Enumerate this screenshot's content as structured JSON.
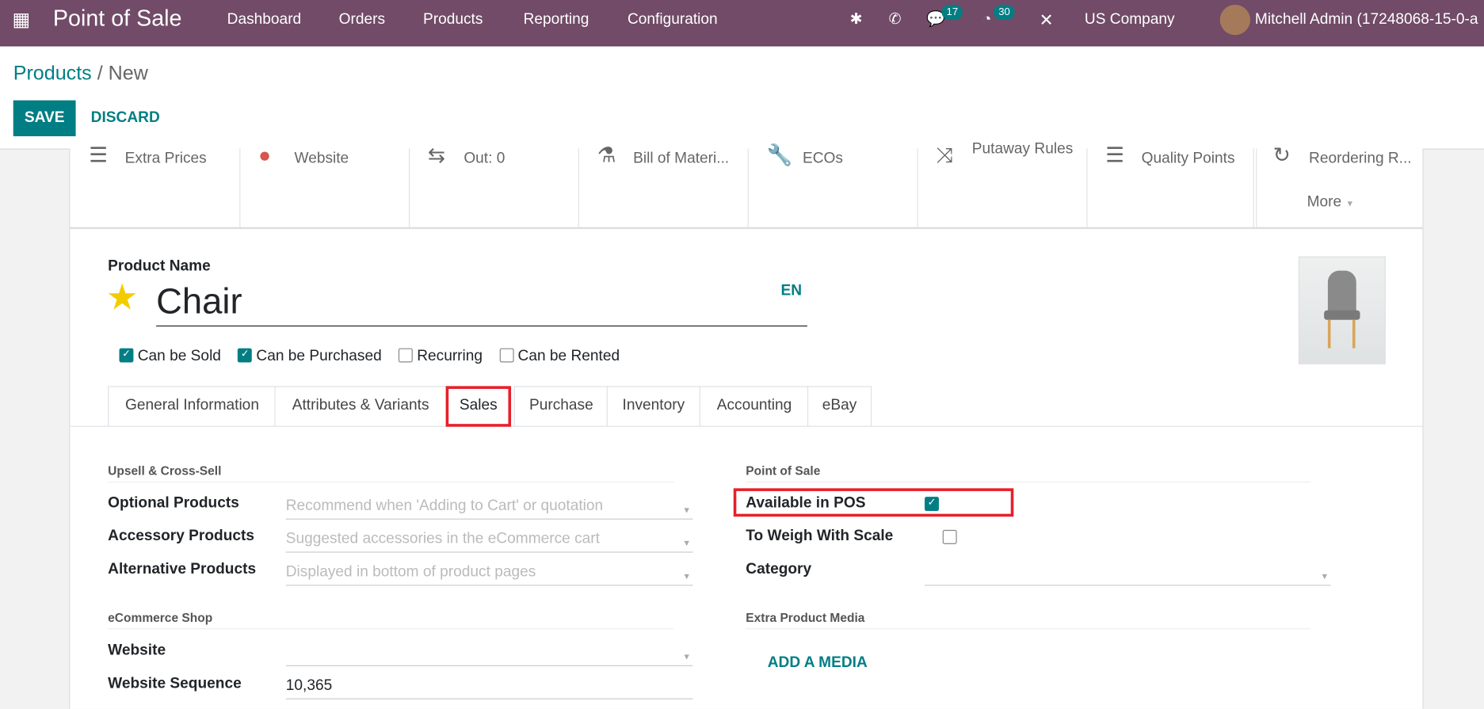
{
  "navbar": {
    "app_title": "Point of Sale",
    "menu": [
      "Dashboard",
      "Orders",
      "Products",
      "Reporting",
      "Configuration"
    ],
    "messages_badge": "17",
    "activities_badge": "30",
    "company": "US Company",
    "user": "Mitchell Admin (17248068-15-0-a",
    "color": "#714b67"
  },
  "breadcrumb": {
    "parent": "Products",
    "current": "/ New"
  },
  "actions": {
    "save": "SAVE",
    "discard": "DISCARD"
  },
  "smart_buttons": [
    {
      "icon": "list-icon",
      "label": "Extra Prices"
    },
    {
      "icon": "globe-icon",
      "label": "Website"
    },
    {
      "icon": "exchange-icon",
      "label": "Out:  0"
    },
    {
      "icon": "flask-icon",
      "label": "Bill of Materi..."
    },
    {
      "icon": "wrench-icon",
      "label": "ECOs"
    },
    {
      "icon": "random-icon",
      "label": "Putaway Rules"
    },
    {
      "icon": "list-icon",
      "label": "Quality Points"
    },
    {
      "icon": "refresh-icon",
      "label": "Reordering R..."
    }
  ],
  "more_label": "More",
  "product": {
    "name_label": "Product Name",
    "name": "Chair",
    "lang": "EN",
    "options": [
      {
        "label": "Can be Sold",
        "checked": true
      },
      {
        "label": "Can be Purchased",
        "checked": true
      },
      {
        "label": "Recurring",
        "checked": false
      },
      {
        "label": "Can be Rented",
        "checked": false
      }
    ]
  },
  "tabs": [
    "General Information",
    "Attributes & Variants",
    "Sales",
    "Purchase",
    "Inventory",
    "Accounting",
    "eBay"
  ],
  "active_tab": "Sales",
  "sales": {
    "upsell": {
      "title": "Upsell & Cross-Sell",
      "fields": [
        {
          "label": "Optional Products",
          "placeholder": "Recommend when 'Adding to Cart' or quotation"
        },
        {
          "label": "Accessory Products",
          "placeholder": "Suggested accessories in the eCommerce cart"
        },
        {
          "label": "Alternative Products",
          "placeholder": "Displayed in bottom of product pages"
        }
      ]
    },
    "ecommerce": {
      "title": "eCommerce Shop",
      "website_label": "Website",
      "website_value": "",
      "sequence_label": "Website Sequence",
      "sequence_value": "10,365"
    },
    "pos": {
      "title": "Point of Sale",
      "available_label": "Available in POS",
      "available": true,
      "weigh_label": "To Weigh With Scale",
      "weigh": false,
      "category_label": "Category",
      "category_value": ""
    },
    "media": {
      "title": "Extra Product Media",
      "add_label": "ADD A MEDIA"
    }
  },
  "colors": {
    "accent": "#017e84",
    "highlight": "#e8202a",
    "star": "#f3cc00"
  }
}
